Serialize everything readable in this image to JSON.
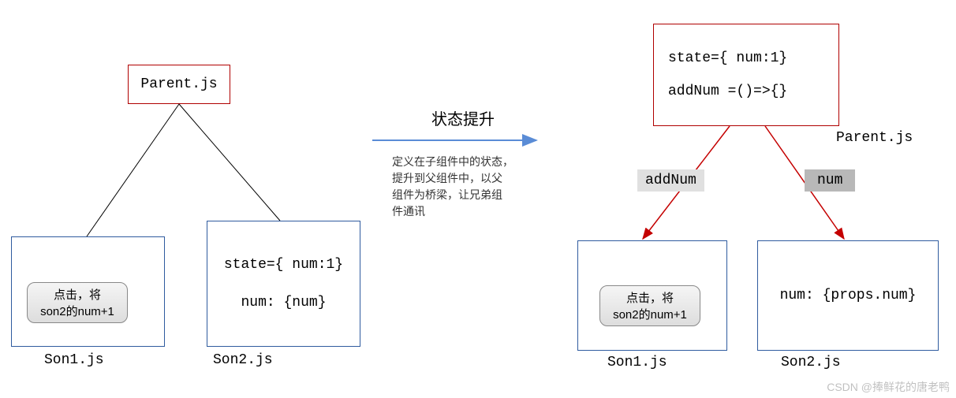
{
  "left": {
    "parent_label": "Parent.js",
    "son1_label": "Son1.js",
    "son2_label": "Son2.js",
    "son1_btn_l1": "点击，将",
    "son1_btn_l2": "son2的num+1",
    "son2_l1": "state={ num:1}",
    "son2_l2": "num: {num}"
  },
  "center": {
    "title": "状态提升",
    "desc_l1": "定义在子组件中的状态，",
    "desc_l2": "提升到父组件中，以父",
    "desc_l3": "组件为桥梁，让兄弟组",
    "desc_l4": "件通讯"
  },
  "right": {
    "parent_label": "Parent.js",
    "parent_l1": "state={ num:1}",
    "parent_l2": "addNum =()=>{}",
    "tag_addnum": "addNum",
    "tag_num": "num",
    "son1_label": "Son1.js",
    "son2_label": "Son2.js",
    "son1_btn_l1": "点击，将",
    "son1_btn_l2": "son2的num+1",
    "son2_l1": "num: {props.num}"
  },
  "watermark": "CSDN @捧鲜花的唐老鸭"
}
